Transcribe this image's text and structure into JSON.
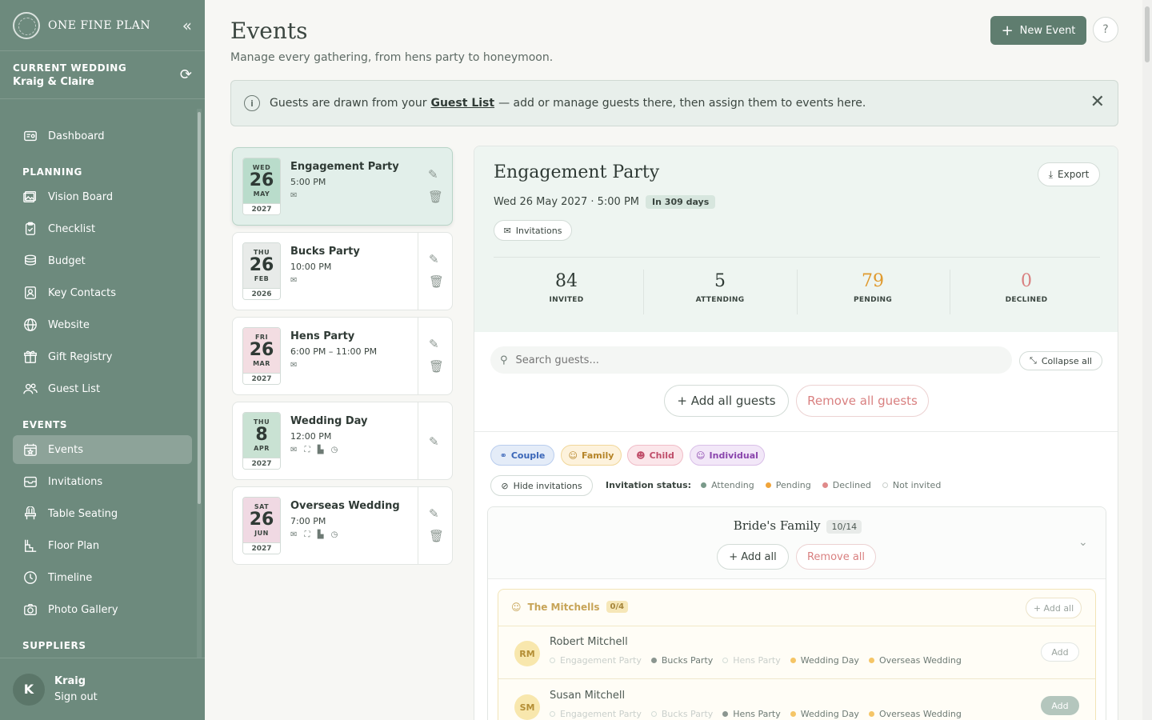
{
  "app": {
    "name": "ONE FINE PLAN",
    "current_wedding_label": "CURRENT WEDDING",
    "current_wedding_name": "Kraig & Claire"
  },
  "sidebar": {
    "top_items": [
      {
        "label": "Dashboard",
        "icon": "dashboard-icon"
      }
    ],
    "sections": [
      {
        "title": "PLANNING",
        "items": [
          {
            "label": "Vision Board",
            "icon": "image-icon"
          },
          {
            "label": "Checklist",
            "icon": "clipboard-icon"
          },
          {
            "label": "Budget",
            "icon": "coins-icon"
          },
          {
            "label": "Key Contacts",
            "icon": "contact-icon"
          },
          {
            "label": "Website",
            "icon": "globe-icon"
          },
          {
            "label": "Gift Registry",
            "icon": "gift-icon"
          },
          {
            "label": "Guest List",
            "icon": "users-icon"
          }
        ]
      },
      {
        "title": "EVENTS",
        "items": [
          {
            "label": "Events",
            "icon": "calendar-icon",
            "active": true
          },
          {
            "label": "Invitations",
            "icon": "envelope-icon"
          },
          {
            "label": "Table Seating",
            "icon": "chair-icon"
          },
          {
            "label": "Floor Plan",
            "icon": "floorplan-icon"
          },
          {
            "label": "Timeline",
            "icon": "clock-icon"
          },
          {
            "label": "Photo Gallery",
            "icon": "camera-icon"
          }
        ]
      },
      {
        "title": "SUPPLIERS",
        "items": []
      }
    ],
    "user": {
      "initial": "K",
      "name": "Kraig",
      "signout": "Sign out"
    }
  },
  "header": {
    "title": "Events",
    "subtitle": "Manage every gathering, from hens party to honeymoon.",
    "new_event_label": "New Event",
    "help_label": "?"
  },
  "banner": {
    "text_before": "Guests are drawn from your",
    "link": "Guest List",
    "text_after": "— add or manage guests there, then assign them to events here."
  },
  "events": [
    {
      "dow": "WED",
      "day": "26",
      "month": "MAY",
      "year": "2027",
      "name": "Engagement Party",
      "time": "5:00 PM",
      "icons": "✉",
      "selected": true,
      "color": "#b9dccb"
    },
    {
      "dow": "THU",
      "day": "26",
      "month": "FEB",
      "year": "2026",
      "name": "Bucks Party",
      "time": "10:00 PM",
      "icons": "✉",
      "color": "#e8ebe9"
    },
    {
      "dow": "FRI",
      "day": "26",
      "month": "MAR",
      "year": "2027",
      "name": "Hens Party",
      "time": "6:00 PM – 11:00 PM",
      "icons": "✉",
      "color": "#f3dde2"
    },
    {
      "dow": "THU",
      "day": "8",
      "month": "APR",
      "year": "2027",
      "name": "Wedding Day",
      "time": "12:00 PM",
      "icons": "✉ ⛶ ▙ ◷",
      "color": "#c9e2d3"
    },
    {
      "dow": "SAT",
      "day": "26",
      "month": "JUN",
      "year": "2027",
      "name": "Overseas Wedding",
      "time": "7:00 PM",
      "icons": "✉ ⛶ ▙ ◷",
      "color": "#f0d9e3"
    }
  ],
  "detail": {
    "title": "Engagement Party",
    "datetime": "Wed 26 May 2027 · 5:00 PM",
    "days_badge": "In 309 days",
    "export_label": "Export",
    "invitations_chip": "Invitations",
    "stats": [
      {
        "value": "84",
        "label": "INVITED",
        "color": "#2f3a35"
      },
      {
        "value": "5",
        "label": "ATTENDING",
        "color": "#2f3a35"
      },
      {
        "value": "79",
        "label": "PENDING",
        "color": "#e09a2e"
      },
      {
        "value": "0",
        "label": "DECLINED",
        "color": "#d98080"
      }
    ],
    "search_placeholder": "Search guests...",
    "collapse_all": "Collapse all",
    "add_all_guests": "+ Add all guests",
    "remove_all_guests": "Remove all guests",
    "tags": [
      {
        "label": "Couple",
        "bg": "#e4ecf8",
        "border": "#b9cdee",
        "color": "#3a66b8"
      },
      {
        "label": "Family",
        "bg": "#fdf2dc",
        "border": "#f1d79a",
        "color": "#b58428"
      },
      {
        "label": "Child",
        "bg": "#fbe6ea",
        "border": "#f0bcc7",
        "color": "#c04e6a"
      },
      {
        "label": "Individual",
        "bg": "#f2e7f8",
        "border": "#d9bfe8",
        "color": "#8a45ad"
      }
    ],
    "hide_invitations": "Hide invitations",
    "legend_title": "Invitation status:",
    "legend": [
      {
        "label": "Attending",
        "color": "#7a9a8a"
      },
      {
        "label": "Pending",
        "color": "#f0a43a"
      },
      {
        "label": "Declined",
        "color": "#e08a8a"
      },
      {
        "label": "Not invited",
        "color": "#ffffff"
      }
    ],
    "group": {
      "title": "Bride's Family",
      "count": "10/14",
      "add_all": "+ Add all",
      "remove_all": "Remove all",
      "family": {
        "title": "The Mitchells",
        "count": "0/4",
        "add_all": "+ Add all",
        "guests": [
          {
            "initials": "RM",
            "name": "Robert Mitchell",
            "add_label": "Add",
            "add_style": "outline",
            "events": [
              {
                "label": "Engagement Party",
                "status": "none"
              },
              {
                "label": "Bucks Party",
                "status": "attending"
              },
              {
                "label": "Hens Party",
                "status": "none"
              },
              {
                "label": "Wedding Day",
                "status": "pending"
              },
              {
                "label": "Overseas Wedding",
                "status": "pending"
              }
            ]
          },
          {
            "initials": "SM",
            "name": "Susan Mitchell",
            "add_label": "Add",
            "add_style": "filled",
            "events": [
              {
                "label": "Engagement Party",
                "status": "none"
              },
              {
                "label": "Bucks Party",
                "status": "none"
              },
              {
                "label": "Hens Party",
                "status": "attending"
              },
              {
                "label": "Wedding Day",
                "status": "pending"
              },
              {
                "label": "Overseas Wedding",
                "status": "pending"
              }
            ]
          }
        ]
      }
    }
  }
}
